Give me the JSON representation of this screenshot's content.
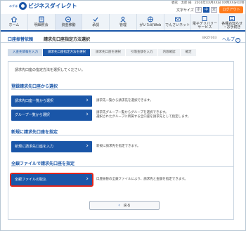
{
  "header": {
    "logo_small": "みずほ",
    "logo_text": "ビジネスダイレクト",
    "user_info": "委託　太郎 様　2016年XX月XX日 XX時XX分XX秒",
    "font_size_label": "文字サイズ",
    "font_sizes": [
      "小",
      "中",
      "大"
    ],
    "logout_label": "ログアウト"
  },
  "nav": {
    "items": [
      {
        "label": "ホーム",
        "icon": "home-icon"
      },
      {
        "label": "明細照会",
        "icon": "statement-icon"
      },
      {
        "label": "資金移動",
        "icon": "transfer-icon"
      },
      {
        "label": "承認",
        "icon": "approval-icon"
      },
      {
        "label": "管理",
        "icon": "admin-icon"
      },
      {
        "label": "がいためWeb",
        "icon": "forex-icon"
      },
      {
        "label": "でんさいネット",
        "icon": "densai-icon"
      },
      {
        "label": "電子デリバリー\nサービス",
        "icon": "delivery-icon"
      },
      {
        "label": "各種お知らせ\n・お手続き",
        "icon": "notice-icon"
      }
    ]
  },
  "title": {
    "category": "口座振替依頼",
    "main": "請求先口座指定方法選択",
    "screen_id": "BKZF003",
    "help_label": "ヘルプ",
    "help_icon": "?"
  },
  "steps": [
    {
      "label": "入金先情報を入力",
      "state": "done"
    },
    {
      "label": "請求先口座指定方法を選択",
      "state": "current"
    },
    {
      "label": "請求先口座を選択",
      "state": "todo"
    },
    {
      "label": "引落金額を入力",
      "state": "todo"
    },
    {
      "label": "内容確認",
      "state": "todo"
    },
    {
      "label": "確定",
      "state": "todo"
    }
  ],
  "intro": "請求先口座の指定方法を選択してください。",
  "sections": [
    {
      "title": "登録請求先口座から選択",
      "buttons": [
        {
          "label": "請求先口座一覧から選択",
          "desc": "請求先一覧から請求先を選択できます。"
        },
        {
          "label": "グループ一覧から選択",
          "desc": "請求先グループ一覧からグループを選択できます。\n選択されたグループに所属する全口座を請求先として指定します。"
        }
      ]
    },
    {
      "title": "新規に請求先口座を指定",
      "buttons": [
        {
          "label": "新規に請求先口座を入力",
          "desc": "新規に請求先を指定できます。"
        }
      ]
    },
    {
      "title": "全銀ファイルで請求先口座を指定",
      "buttons": [
        {
          "label": "全銀ファイルの取込",
          "desc": "口座振替の全銀ファイルにより、請求先と金額を指定できます。"
        }
      ]
    }
  ],
  "back_label": "戻る",
  "colors": {
    "primary": "#1a56a8",
    "logout": "#ff7b1c",
    "highlight": "#e0241b"
  }
}
